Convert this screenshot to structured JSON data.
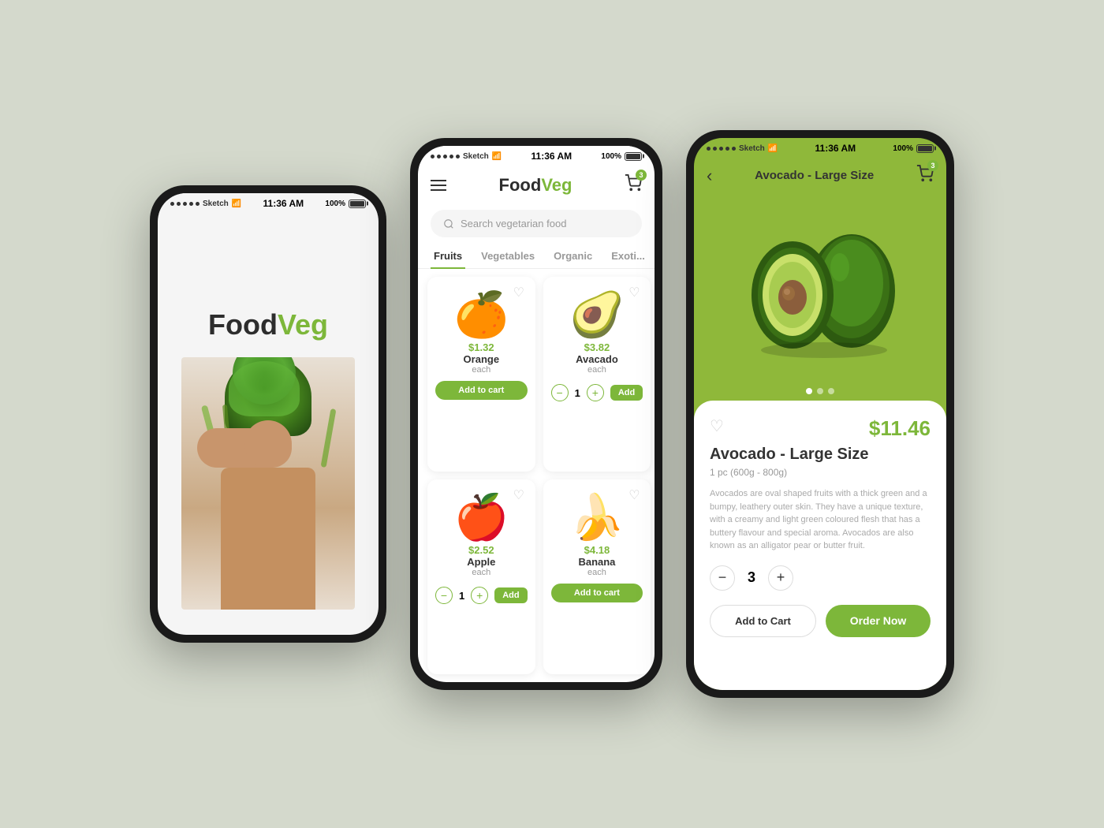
{
  "background": "#d4d9cc",
  "statusBar": {
    "signals": "••••• Sketch",
    "wifi": "wifi",
    "time": "11:36 AM",
    "battery": "100%"
  },
  "phone1": {
    "logo": {
      "food": "Food",
      "veg": "Veg"
    }
  },
  "phone2": {
    "logo": {
      "food": "Food",
      "veg": "Veg"
    },
    "cartBadge": "3",
    "search": {
      "placeholder": "Search vegetarian food"
    },
    "tabs": [
      "Fruits",
      "Vegetables",
      "Organic",
      "Exoti..."
    ],
    "activeTab": "Fruits",
    "products": [
      {
        "name": "Orange",
        "price": "$1.32",
        "unit": "each",
        "emoji": "🍊",
        "action": "add_to_cart",
        "btnLabel": "Add to cart"
      },
      {
        "name": "Avacado",
        "price": "$3.82",
        "unit": "each",
        "emoji": "🥑",
        "action": "qty",
        "qty": "1",
        "addLabel": "Add"
      },
      {
        "name": "Apple",
        "price": "$2.52",
        "unit": "each",
        "emoji": "🍎",
        "action": "qty",
        "qty": "1",
        "addLabel": "Add"
      },
      {
        "name": "Banana",
        "price": "$4.18",
        "unit": "each",
        "emoji": "🍌",
        "action": "add_to_cart",
        "btnLabel": "Add to cart"
      }
    ]
  },
  "phone3": {
    "cartBadge": "3",
    "backLabel": "‹",
    "title": "Avocado - Large Size",
    "price": "$11.46",
    "productName": "Avocado - Large Size",
    "productSub": "1 pc (600g - 800g)",
    "description": "Avocados are oval shaped fruits with a thick green and a bumpy, leathery outer skin. They have a unique texture, with a creamy and light green coloured flesh that has a buttery flavour and special aroma. Avocados are also known as an alligator pear or butter fruit.",
    "qty": "3",
    "addToCartLabel": "Add to Cart",
    "orderNowLabel": "Order Now"
  }
}
